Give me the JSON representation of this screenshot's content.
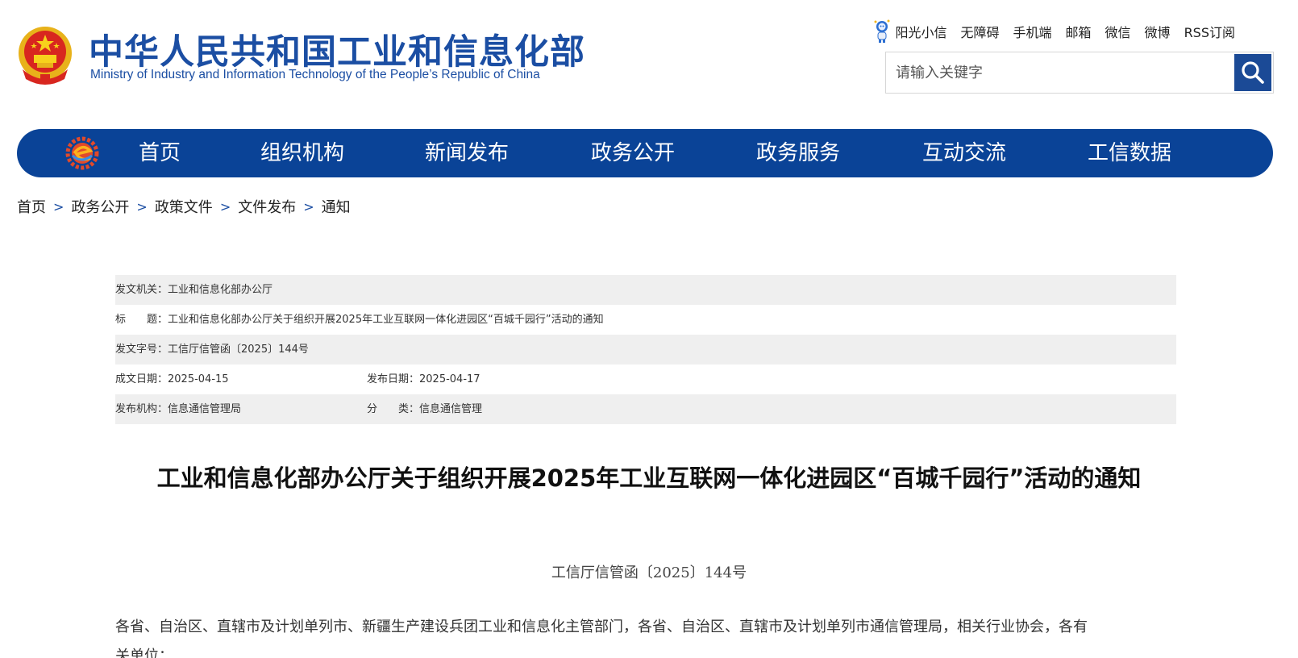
{
  "header": {
    "title": "中华人民共和国工业和信息化部",
    "subtitle": "Ministry of Industry and Information Technology of the People’s Republic of China",
    "top_links": [
      "阳光小信",
      "无障碍",
      "手机端",
      "邮箱",
      "微信",
      "微博",
      "RSS订阅"
    ],
    "search_placeholder": "请输入关键字",
    "icons": {
      "emblem": "national-emblem-icon",
      "robot": "robot-mascot-icon",
      "search": "search-icon"
    }
  },
  "nav": {
    "items": [
      "首页",
      "组织机构",
      "新闻发布",
      "政务公开",
      "政务服务",
      "互动交流",
      "工信数据"
    ],
    "color": "#0a4397",
    "logo_icon": "gear-e-logo-icon"
  },
  "breadcrumb": [
    "首页",
    "政务公开",
    "政策文件",
    "文件发布",
    "通知"
  ],
  "breadcrumb_sep": ">",
  "meta": {
    "issuer_label": "发文机关：",
    "issuer": "工业和信息化部办公厅",
    "title_label": "标　　题：",
    "title": "工业和信息化部办公厅关于组织开展2025年工业互联网一体化进园区“百城千园行”活动的通知",
    "docno_label": "发文字号：",
    "docno": "工信厅信管函〔2025〕144号",
    "created_label": "成文日期：",
    "created": "2025-04-15",
    "published_label": "发布日期：",
    "published": "2025-04-17",
    "agency_label": "发布机构：",
    "agency": "信息通信管理局",
    "category_label": "分　　类：",
    "category": "信息通信管理"
  },
  "article": {
    "title": "工业和信息化部办公厅关于组织开展2025年工业互联网一体化进园区“百城千园行”活动的通知",
    "doc_number": "工信厅信管函〔2025〕144号",
    "addressees_line1": "各省、自治区、直辖市及计划单列市、新疆生产建设兵团工业和信息化主管部门，各省、自治区、直辖市及计划单列市通信管理局，相关行业协会，各有",
    "addressees_line2": "关单位："
  }
}
